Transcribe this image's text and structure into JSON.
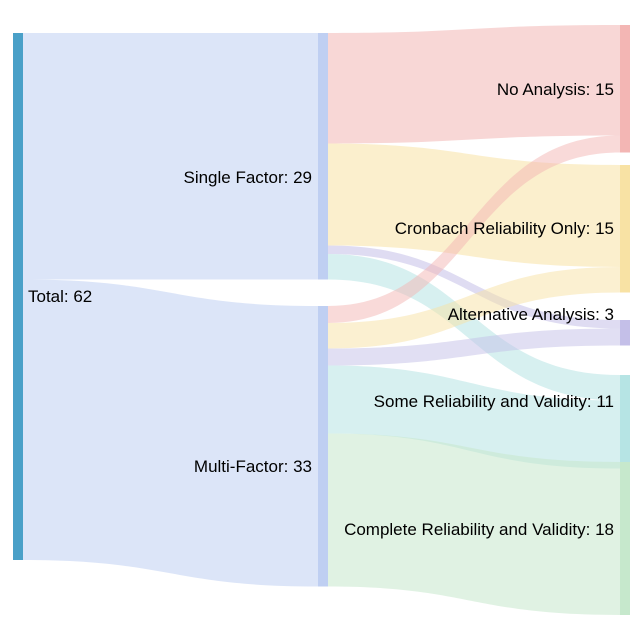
{
  "chart_data": {
    "type": "sankey",
    "nodes": [
      {
        "id": "total",
        "label": "Total: 62",
        "value": 62
      },
      {
        "id": "single",
        "label": "Single Factor: 29",
        "value": 29
      },
      {
        "id": "multi",
        "label": "Multi-Factor: 33",
        "value": 33
      },
      {
        "id": "none",
        "label": "No Analysis: 15",
        "value": 15
      },
      {
        "id": "cron",
        "label": "Cronbach Reliability Only: 15",
        "value": 15
      },
      {
        "id": "alt",
        "label": "Alternative Analysis: 3",
        "value": 3
      },
      {
        "id": "some",
        "label": "Some Reliability and Validity: 11",
        "value": 11
      },
      {
        "id": "comp",
        "label": "Complete Reliability and Validity: 18",
        "value": 18
      }
    ],
    "links": [
      {
        "source": "total",
        "target": "single",
        "value": 29
      },
      {
        "source": "total",
        "target": "multi",
        "value": 33
      },
      {
        "source": "single",
        "target": "none",
        "value": 13
      },
      {
        "source": "single",
        "target": "cron",
        "value": 12
      },
      {
        "source": "single",
        "target": "alt",
        "value": 1
      },
      {
        "source": "single",
        "target": "some",
        "value": 3
      },
      {
        "source": "multi",
        "target": "none",
        "value": 2
      },
      {
        "source": "multi",
        "target": "cron",
        "value": 3
      },
      {
        "source": "multi",
        "target": "alt",
        "value": 2
      },
      {
        "source": "multi",
        "target": "some",
        "value": 8
      },
      {
        "source": "multi",
        "target": "comp",
        "value": 18
      }
    ],
    "colors": {
      "total": "#4aa0c8",
      "factor": "#bfcff2",
      "none": "#f3b6b4",
      "cron": "#f8e2a4",
      "alt": "#c4bfe8",
      "some": "#b6e4e4",
      "comp": "#c6e8cc"
    }
  }
}
